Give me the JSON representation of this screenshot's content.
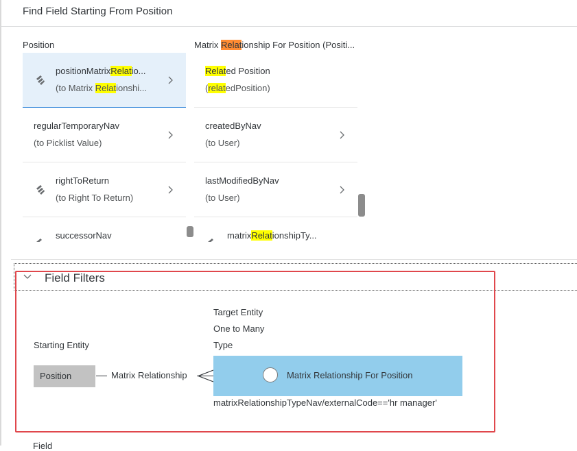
{
  "dialog": {
    "title": "Find Field Starting From Position"
  },
  "columns": [
    {
      "header": {
        "pre": "",
        "hl": "",
        "hl_current": "",
        "post": "Position"
      },
      "items": [
        {
          "l1_pre": "positionMatrix",
          "l1_hl": "Relat",
          "l1_post": "io...",
          "l2_pre": "(to Matrix ",
          "l2_hl": "Relat",
          "l2_post": "ionshi...",
          "icon": "navigation-icon",
          "chevron": true,
          "selected": true
        },
        {
          "l1_pre": "regularTemporaryNav",
          "l1_hl": "",
          "l1_post": "",
          "l2_pre": "(to Picklist Value)",
          "l2_hl": "",
          "l2_post": "",
          "icon": "",
          "chevron": true,
          "selected": false
        },
        {
          "l1_pre": "rightToReturn",
          "l1_hl": "",
          "l1_post": "",
          "l2_pre": "(to Right To Return)",
          "l2_hl": "",
          "l2_post": "",
          "icon": "navigation-icon",
          "chevron": true,
          "selected": false
        },
        {
          "l1_pre": "successorNav",
          "l1_hl": "",
          "l1_post": "",
          "l2_pre": "",
          "l2_hl": "",
          "l2_post": "",
          "icon": "navigation-icon",
          "chevron": false,
          "selected": false
        }
      ]
    },
    {
      "header": {
        "pre": "Matrix ",
        "hl": "",
        "hl_current": "Relat",
        "post": "ionship For Position (Positi..."
      },
      "items": [
        {
          "l1_pre": "",
          "l1_hl": "Relat",
          "l1_post": "ed Position",
          "l2_pre": "(",
          "l2_hl": "relat",
          "l2_post": "edPosition)",
          "icon": "",
          "chevron": false,
          "selected": false
        },
        {
          "l1_pre": "createdByNav",
          "l1_hl": "",
          "l1_post": "",
          "l2_pre": "(to User)",
          "l2_hl": "",
          "l2_post": "",
          "icon": "",
          "chevron": true,
          "selected": false
        },
        {
          "l1_pre": "lastModifiedByNav",
          "l1_hl": "",
          "l1_post": "",
          "l2_pre": "(to User)",
          "l2_hl": "",
          "l2_post": "",
          "icon": "",
          "chevron": true,
          "selected": false
        },
        {
          "l1_pre": "matrix",
          "l1_hl": "Relat",
          "l1_post": "ionshipTy...",
          "l2_pre": "",
          "l2_hl": "",
          "l2_post": "",
          "icon": "navigation-icon",
          "chevron": false,
          "selected": false
        }
      ]
    }
  ],
  "filters": {
    "title": "Field Filters",
    "target_entity_label": "Target Entity",
    "cardinality": "One to Many",
    "type_label": "Type",
    "starting_entity_label": "Starting Entity",
    "starting_entity": "Position",
    "relationship_label": "Matrix Relationship",
    "target_entity": "Matrix Relationship For Position",
    "filter_expression": "matrixRelationshipTypeNav/externalCode=='hr manager'"
  },
  "below_text": "Field",
  "colors": {
    "highlight": "#ffff00",
    "highlight_current": "#ff8c32",
    "selected_bg": "#e5f0fa",
    "selected_border": "#0a6ed1",
    "target_bg": "#92cdec",
    "annotation_red": "#e0474c"
  }
}
